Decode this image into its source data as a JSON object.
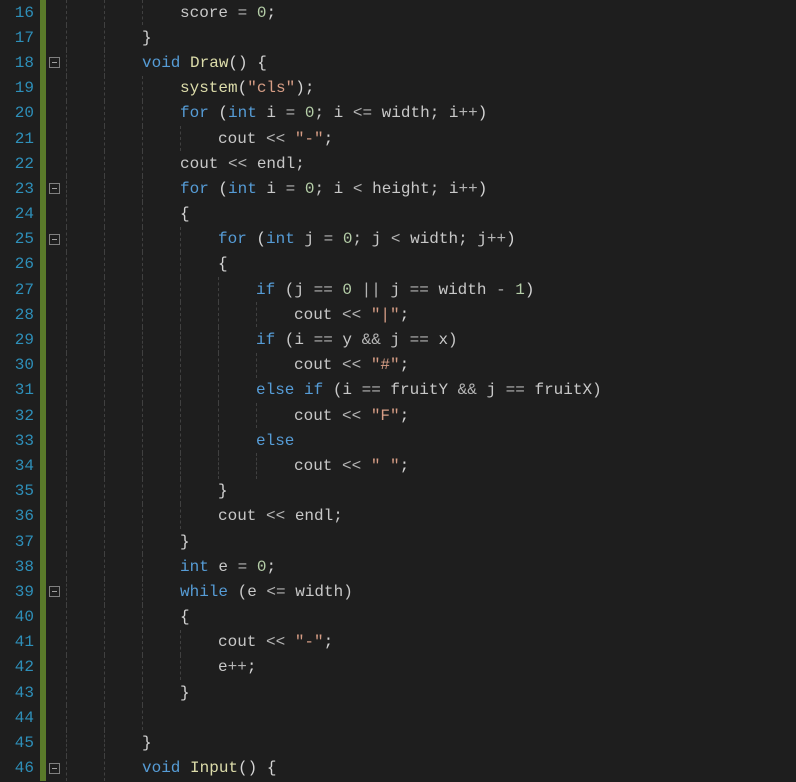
{
  "editor": {
    "lineHeight": 25.2,
    "indentWidthPx": 38,
    "lines": [
      {
        "num": 16,
        "fold": null,
        "guides": [
          0,
          1,
          2
        ],
        "indent": 3,
        "tokens": [
          {
            "t": "score",
            "c": "c-ident"
          },
          {
            "t": " ",
            "c": "c-default"
          },
          {
            "t": "=",
            "c": "c-op"
          },
          {
            "t": " ",
            "c": "c-default"
          },
          {
            "t": "0",
            "c": "c-number"
          },
          {
            "t": ";",
            "c": "c-punct"
          }
        ]
      },
      {
        "num": 17,
        "fold": null,
        "guides": [
          0,
          1
        ],
        "indent": 2,
        "tokens": [
          {
            "t": "}",
            "c": "c-punct"
          }
        ]
      },
      {
        "num": 18,
        "fold": "box",
        "guides": [
          0,
          1
        ],
        "indent": 2,
        "tokens": [
          {
            "t": "void",
            "c": "c-type"
          },
          {
            "t": " ",
            "c": "c-default"
          },
          {
            "t": "Draw",
            "c": "c-func"
          },
          {
            "t": "() {",
            "c": "c-punct"
          }
        ]
      },
      {
        "num": 19,
        "fold": "line",
        "guides": [
          0,
          1,
          2
        ],
        "indent": 3,
        "tokens": [
          {
            "t": "system",
            "c": "c-func"
          },
          {
            "t": "(",
            "c": "c-punct"
          },
          {
            "t": "\"cls\"",
            "c": "c-string"
          },
          {
            "t": ");",
            "c": "c-punct"
          }
        ]
      },
      {
        "num": 20,
        "fold": "line",
        "guides": [
          0,
          1,
          2
        ],
        "indent": 3,
        "tokens": [
          {
            "t": "for",
            "c": "c-keyword"
          },
          {
            "t": " (",
            "c": "c-punct"
          },
          {
            "t": "int",
            "c": "c-type"
          },
          {
            "t": " i ",
            "c": "c-ident"
          },
          {
            "t": "=",
            "c": "c-op"
          },
          {
            "t": " ",
            "c": "c-default"
          },
          {
            "t": "0",
            "c": "c-number"
          },
          {
            "t": "; i ",
            "c": "c-ident"
          },
          {
            "t": "<=",
            "c": "c-op"
          },
          {
            "t": " width; i",
            "c": "c-ident"
          },
          {
            "t": "++",
            "c": "c-op"
          },
          {
            "t": ")",
            "c": "c-punct"
          }
        ]
      },
      {
        "num": 21,
        "fold": "line",
        "guides": [
          0,
          1,
          2,
          3
        ],
        "indent": 4,
        "tokens": [
          {
            "t": "cout ",
            "c": "c-ident"
          },
          {
            "t": "<<",
            "c": "c-op"
          },
          {
            "t": " ",
            "c": "c-default"
          },
          {
            "t": "\"-\"",
            "c": "c-string"
          },
          {
            "t": ";",
            "c": "c-punct"
          }
        ]
      },
      {
        "num": 22,
        "fold": "line",
        "guides": [
          0,
          1,
          2
        ],
        "indent": 3,
        "tokens": [
          {
            "t": "cout ",
            "c": "c-ident"
          },
          {
            "t": "<<",
            "c": "c-op"
          },
          {
            "t": " endl;",
            "c": "c-ident"
          }
        ]
      },
      {
        "num": 23,
        "fold": "box",
        "guides": [
          0,
          1,
          2
        ],
        "indent": 3,
        "tokens": [
          {
            "t": "for",
            "c": "c-keyword"
          },
          {
            "t": " (",
            "c": "c-punct"
          },
          {
            "t": "int",
            "c": "c-type"
          },
          {
            "t": " i ",
            "c": "c-ident"
          },
          {
            "t": "=",
            "c": "c-op"
          },
          {
            "t": " ",
            "c": "c-default"
          },
          {
            "t": "0",
            "c": "c-number"
          },
          {
            "t": "; i ",
            "c": "c-ident"
          },
          {
            "t": "<",
            "c": "c-op"
          },
          {
            "t": " height; i",
            "c": "c-ident"
          },
          {
            "t": "++",
            "c": "c-op"
          },
          {
            "t": ")",
            "c": "c-punct"
          }
        ]
      },
      {
        "num": 24,
        "fold": "line",
        "guides": [
          0,
          1,
          2
        ],
        "indent": 3,
        "tokens": [
          {
            "t": "{",
            "c": "c-punct"
          }
        ]
      },
      {
        "num": 25,
        "fold": "box",
        "guides": [
          0,
          1,
          2,
          3
        ],
        "indent": 4,
        "tokens": [
          {
            "t": "for",
            "c": "c-keyword"
          },
          {
            "t": " (",
            "c": "c-punct"
          },
          {
            "t": "int",
            "c": "c-type"
          },
          {
            "t": " j ",
            "c": "c-ident"
          },
          {
            "t": "=",
            "c": "c-op"
          },
          {
            "t": " ",
            "c": "c-default"
          },
          {
            "t": "0",
            "c": "c-number"
          },
          {
            "t": "; j ",
            "c": "c-ident"
          },
          {
            "t": "<",
            "c": "c-op"
          },
          {
            "t": " width; j",
            "c": "c-ident"
          },
          {
            "t": "++",
            "c": "c-op"
          },
          {
            "t": ")",
            "c": "c-punct"
          }
        ]
      },
      {
        "num": 26,
        "fold": "line",
        "guides": [
          0,
          1,
          2,
          3
        ],
        "indent": 4,
        "tokens": [
          {
            "t": "{",
            "c": "c-punct"
          }
        ]
      },
      {
        "num": 27,
        "fold": "line",
        "guides": [
          0,
          1,
          2,
          3,
          4
        ],
        "indent": 5,
        "tokens": [
          {
            "t": "if",
            "c": "c-keyword"
          },
          {
            "t": " (j ",
            "c": "c-ident"
          },
          {
            "t": "==",
            "c": "c-op"
          },
          {
            "t": " ",
            "c": "c-default"
          },
          {
            "t": "0",
            "c": "c-number"
          },
          {
            "t": " ",
            "c": "c-default"
          },
          {
            "t": "||",
            "c": "c-op"
          },
          {
            "t": " j ",
            "c": "c-ident"
          },
          {
            "t": "==",
            "c": "c-op"
          },
          {
            "t": " width ",
            "c": "c-ident"
          },
          {
            "t": "-",
            "c": "c-op"
          },
          {
            "t": " ",
            "c": "c-default"
          },
          {
            "t": "1",
            "c": "c-number"
          },
          {
            "t": ")",
            "c": "c-punct"
          }
        ]
      },
      {
        "num": 28,
        "fold": "line",
        "guides": [
          0,
          1,
          2,
          3,
          4,
          5
        ],
        "indent": 6,
        "tokens": [
          {
            "t": "cout ",
            "c": "c-ident"
          },
          {
            "t": "<<",
            "c": "c-op"
          },
          {
            "t": " ",
            "c": "c-default"
          },
          {
            "t": "\"|\"",
            "c": "c-string"
          },
          {
            "t": ";",
            "c": "c-punct"
          }
        ]
      },
      {
        "num": 29,
        "fold": "line",
        "guides": [
          0,
          1,
          2,
          3,
          4
        ],
        "indent": 5,
        "tokens": [
          {
            "t": "if",
            "c": "c-keyword"
          },
          {
            "t": " (i ",
            "c": "c-ident"
          },
          {
            "t": "==",
            "c": "c-op"
          },
          {
            "t": " y ",
            "c": "c-ident"
          },
          {
            "t": "&&",
            "c": "c-op"
          },
          {
            "t": " j ",
            "c": "c-ident"
          },
          {
            "t": "==",
            "c": "c-op"
          },
          {
            "t": " x)",
            "c": "c-ident"
          }
        ]
      },
      {
        "num": 30,
        "fold": "line",
        "guides": [
          0,
          1,
          2,
          3,
          4,
          5
        ],
        "indent": 6,
        "tokens": [
          {
            "t": "cout ",
            "c": "c-ident"
          },
          {
            "t": "<<",
            "c": "c-op"
          },
          {
            "t": " ",
            "c": "c-default"
          },
          {
            "t": "\"#\"",
            "c": "c-string"
          },
          {
            "t": ";",
            "c": "c-punct"
          }
        ]
      },
      {
        "num": 31,
        "fold": "line",
        "guides": [
          0,
          1,
          2,
          3,
          4
        ],
        "indent": 5,
        "tokens": [
          {
            "t": "else if",
            "c": "c-keyword"
          },
          {
            "t": " (i ",
            "c": "c-ident"
          },
          {
            "t": "==",
            "c": "c-op"
          },
          {
            "t": " fruitY ",
            "c": "c-ident"
          },
          {
            "t": "&&",
            "c": "c-op"
          },
          {
            "t": " j ",
            "c": "c-ident"
          },
          {
            "t": "==",
            "c": "c-op"
          },
          {
            "t": " fruitX)",
            "c": "c-ident"
          }
        ]
      },
      {
        "num": 32,
        "fold": "line",
        "guides": [
          0,
          1,
          2,
          3,
          4,
          5
        ],
        "indent": 6,
        "tokens": [
          {
            "t": "cout ",
            "c": "c-ident"
          },
          {
            "t": "<<",
            "c": "c-op"
          },
          {
            "t": " ",
            "c": "c-default"
          },
          {
            "t": "\"F\"",
            "c": "c-string"
          },
          {
            "t": ";",
            "c": "c-punct"
          }
        ]
      },
      {
        "num": 33,
        "fold": "line",
        "guides": [
          0,
          1,
          2,
          3,
          4
        ],
        "indent": 5,
        "tokens": [
          {
            "t": "else",
            "c": "c-keyword"
          }
        ]
      },
      {
        "num": 34,
        "fold": "line",
        "guides": [
          0,
          1,
          2,
          3,
          4,
          5
        ],
        "indent": 6,
        "tokens": [
          {
            "t": "cout ",
            "c": "c-ident"
          },
          {
            "t": "<<",
            "c": "c-op"
          },
          {
            "t": " ",
            "c": "c-default"
          },
          {
            "t": "\" \"",
            "c": "c-string"
          },
          {
            "t": ";",
            "c": "c-punct"
          }
        ]
      },
      {
        "num": 35,
        "fold": "line",
        "guides": [
          0,
          1,
          2,
          3
        ],
        "indent": 4,
        "tokens": [
          {
            "t": "}",
            "c": "c-punct"
          }
        ]
      },
      {
        "num": 36,
        "fold": "line",
        "guides": [
          0,
          1,
          2,
          3
        ],
        "indent": 4,
        "tokens": [
          {
            "t": "cout ",
            "c": "c-ident"
          },
          {
            "t": "<<",
            "c": "c-op"
          },
          {
            "t": " endl;",
            "c": "c-ident"
          }
        ]
      },
      {
        "num": 37,
        "fold": "line",
        "guides": [
          0,
          1,
          2
        ],
        "indent": 3,
        "tokens": [
          {
            "t": "}",
            "c": "c-punct"
          }
        ]
      },
      {
        "num": 38,
        "fold": "line",
        "guides": [
          0,
          1,
          2
        ],
        "indent": 3,
        "tokens": [
          {
            "t": "int",
            "c": "c-type"
          },
          {
            "t": " e ",
            "c": "c-ident"
          },
          {
            "t": "=",
            "c": "c-op"
          },
          {
            "t": " ",
            "c": "c-default"
          },
          {
            "t": "0",
            "c": "c-number"
          },
          {
            "t": ";",
            "c": "c-punct"
          }
        ]
      },
      {
        "num": 39,
        "fold": "box",
        "guides": [
          0,
          1,
          2
        ],
        "indent": 3,
        "tokens": [
          {
            "t": "while",
            "c": "c-keyword"
          },
          {
            "t": " (e ",
            "c": "c-ident"
          },
          {
            "t": "<=",
            "c": "c-op"
          },
          {
            "t": " width)",
            "c": "c-ident"
          }
        ]
      },
      {
        "num": 40,
        "fold": "line",
        "guides": [
          0,
          1,
          2
        ],
        "indent": 3,
        "tokens": [
          {
            "t": "{",
            "c": "c-punct"
          }
        ]
      },
      {
        "num": 41,
        "fold": "line",
        "guides": [
          0,
          1,
          2,
          3
        ],
        "indent": 4,
        "tokens": [
          {
            "t": "cout ",
            "c": "c-ident"
          },
          {
            "t": "<<",
            "c": "c-op"
          },
          {
            "t": " ",
            "c": "c-default"
          },
          {
            "t": "\"-\"",
            "c": "c-string"
          },
          {
            "t": ";",
            "c": "c-punct"
          }
        ]
      },
      {
        "num": 42,
        "fold": "line",
        "guides": [
          0,
          1,
          2,
          3
        ],
        "indent": 4,
        "tokens": [
          {
            "t": "e",
            "c": "c-ident"
          },
          {
            "t": "++",
            "c": "c-op"
          },
          {
            "t": ";",
            "c": "c-punct"
          }
        ]
      },
      {
        "num": 43,
        "fold": "line",
        "guides": [
          0,
          1,
          2
        ],
        "indent": 3,
        "tokens": [
          {
            "t": "}",
            "c": "c-punct"
          }
        ]
      },
      {
        "num": 44,
        "fold": "line",
        "guides": [
          0,
          1,
          2
        ],
        "indent": 0,
        "tokens": []
      },
      {
        "num": 45,
        "fold": "line",
        "guides": [
          0,
          1
        ],
        "indent": 2,
        "tokens": [
          {
            "t": "}",
            "c": "c-punct"
          }
        ]
      },
      {
        "num": 46,
        "fold": "box",
        "guides": [
          0,
          1
        ],
        "indent": 2,
        "tokens": [
          {
            "t": "void",
            "c": "c-type"
          },
          {
            "t": " ",
            "c": "c-default"
          },
          {
            "t": "Input",
            "c": "c-func"
          },
          {
            "t": "() {",
            "c": "c-punct"
          }
        ]
      }
    ]
  }
}
